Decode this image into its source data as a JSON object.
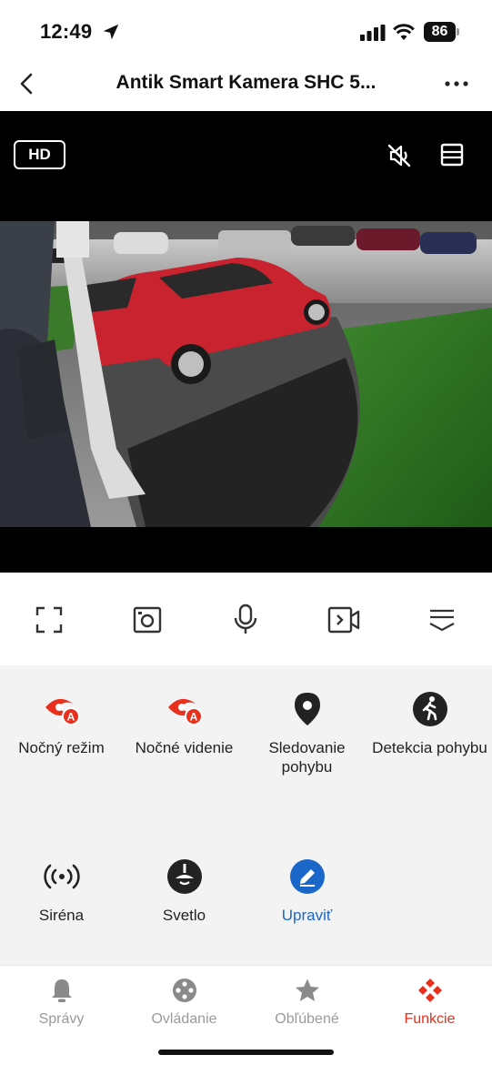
{
  "status_bar": {
    "time": "12:49",
    "battery": "86"
  },
  "header": {
    "title": "Antik Smart Kamera SHC 5..."
  },
  "video": {
    "quality_badge": "HD"
  },
  "functions": [
    {
      "label": "Nočný režim",
      "icon": "night-mode-auto-icon"
    },
    {
      "label": "Nočné videnie",
      "icon": "night-vision-auto-icon"
    },
    {
      "label": "Sledovanie pohybu",
      "icon": "location-pin-icon"
    },
    {
      "label": "Detekcia pohybu",
      "icon": "walking-person-icon"
    },
    {
      "label": "Siréna",
      "icon": "siren-icon"
    },
    {
      "label": "Svetlo",
      "icon": "light-icon"
    },
    {
      "label": "Upraviť",
      "icon": "edit-icon"
    }
  ],
  "tabs": [
    {
      "label": "Správy",
      "icon": "bell-icon",
      "active": false
    },
    {
      "label": "Ovládanie",
      "icon": "control-icon",
      "active": false
    },
    {
      "label": "Obľúbené",
      "icon": "star-icon",
      "active": false
    },
    {
      "label": "Funkcie",
      "icon": "functions-icon",
      "active": true
    }
  ],
  "colors": {
    "accent_red": "#e8301c",
    "link_blue": "#1a66c9",
    "panel_bg": "#f3f3f3"
  }
}
